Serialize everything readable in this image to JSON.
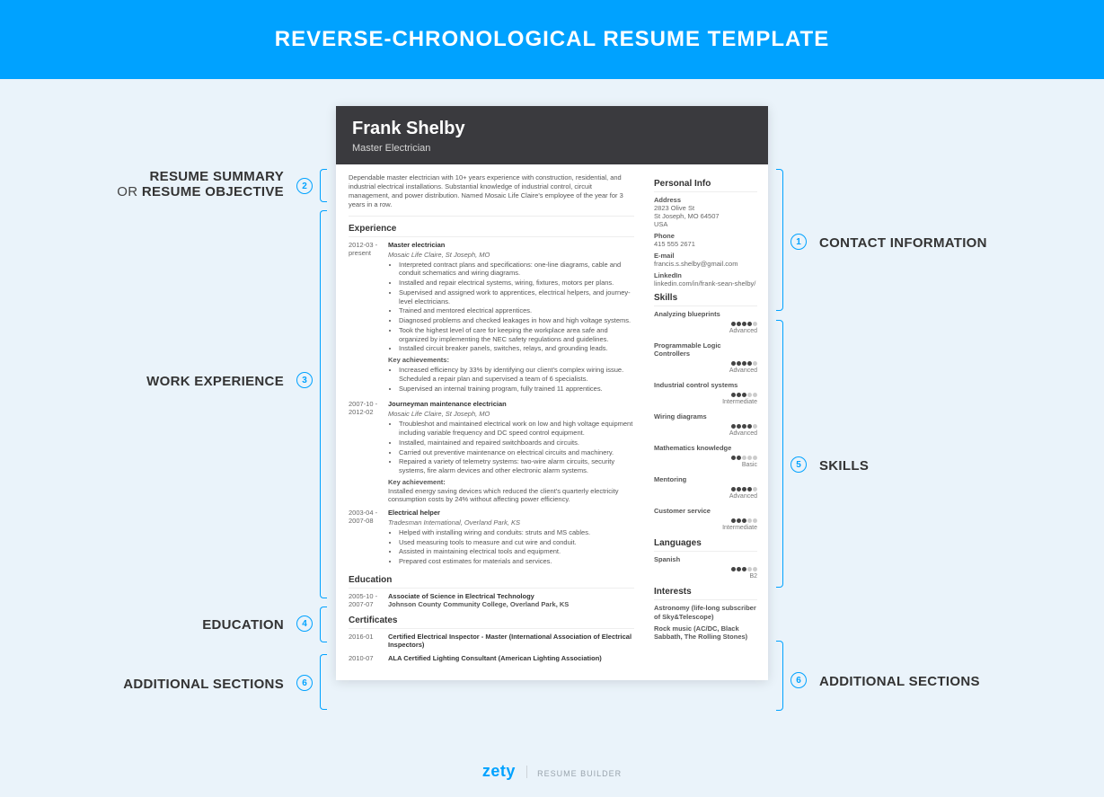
{
  "banner": {
    "title": "REVERSE-CHRONOLOGICAL RESUME TEMPLATE"
  },
  "labels": {
    "summary_l1": "RESUME SUMMARY",
    "summary_l2_pre": "OR ",
    "summary_l2": "RESUME OBJECTIVE",
    "experience": "WORK EXPERIENCE",
    "education": "EDUCATION",
    "additional": "ADDITIONAL SECTIONS",
    "contact": "CONTACT INFORMATION",
    "skills": "SKILLS",
    "additional_r": "ADDITIONAL SECTIONS"
  },
  "badges": {
    "n1": "1",
    "n2": "2",
    "n3": "3",
    "n4": "4",
    "n5": "5",
    "n6": "6",
    "n6b": "6"
  },
  "resume": {
    "name": "Frank Shelby",
    "role": "Master Electrician",
    "summary": "Dependable master electrician with 10+ years experience with construction, residential, and industrial electrical installations. Substantial knowledge of industrial control, circuit management, and power distribution. Named Mosaic Life Claire's employee of the year for 3 years in a row.",
    "sections": {
      "experience": "Experience",
      "education": "Education",
      "certificates": "Certificates",
      "personal": "Personal Info",
      "skills": "Skills",
      "languages": "Languages",
      "interests": "Interests"
    },
    "jobs": [
      {
        "dates": "2012-03 - present",
        "title": "Master electrician",
        "loc": "Mosaic Life Claire, St Joseph, MO",
        "bullets": [
          "Interpreted contract plans and specifications: one-line diagrams, cable and conduit schematics and wiring diagrams.",
          "Installed and repair electrical systems, wiring, fixtures, motors per plans.",
          "Supervised and assigned work to apprentices, electrical helpers, and journey-level electricians.",
          "Trained and mentored electrical apprentices.",
          "Diagnosed problems and checked leakages in how and high voltage systems.",
          "Took the highest level of care for keeping the workplace area safe and organized by implementing the NEC safety regulations and guidelines.",
          "Installed circuit breaker panels, switches, relays, and grounding leads."
        ],
        "key_label": "Key achievements:",
        "key_bullets": [
          "Increased efficiency by 33% by identifying our client's complex wiring issue. Scheduled a repair plan and supervised a team of 6 specialists.",
          "Supervised an internal training program, fully trained 11 apprentices."
        ]
      },
      {
        "dates": "2007-10 - 2012-02",
        "title": "Journeyman maintenance electrician",
        "loc": "Mosaic Life Claire, St Joseph, MO",
        "bullets": [
          "Troubleshot and maintained electrical work on low and high voltage equipment including variable frequency and DC speed control equipment.",
          "Installed, maintained and repaired switchboards and circuits.",
          "Carried out preventive maintenance on electrical circuits and machinery.",
          "Repaired a variety of telemetry systems: two-wire alarm circuits, security systems, fire alarm devices and other electronic alarm systems."
        ],
        "key_label": "Key achievement:",
        "key_text": "Installed energy saving devices which reduced the client's quarterly electricity consumption costs by 24% without affecting power efficiency."
      },
      {
        "dates": "2003-04 - 2007-08",
        "title": "Electrical helper",
        "loc": "Tradesman International, Overland Park, KS",
        "bullets": [
          "Helped with installing wiring and conduits: struts and MS cables.",
          "Used measuring tools to measure and cut wire and conduit.",
          "Assisted in maintaining electrical tools and equipment.",
          "Prepared cost estimates for materials and services."
        ]
      }
    ],
    "education": {
      "dates": "2005-10 - 2007-07",
      "degree": "Associate of Science in Electrical Technology",
      "school": "Johnson County Community College, Overland Park, KS"
    },
    "certs": [
      {
        "date": "2016-01",
        "text": "Certified Electrical Inspector - Master (International Association of Electrical Inspectors)"
      },
      {
        "date": "2010-07",
        "text": "ALA Certified Lighting Consultant (American Lighting Association)"
      }
    ],
    "personal": {
      "address_label": "Address",
      "address_l1": "2823 Olive St",
      "address_l2": "St Joseph, MO 64507",
      "address_l3": "USA",
      "phone_label": "Phone",
      "phone": "415 555 2671",
      "email_label": "E-mail",
      "email": "francis.s.shelby@gmail.com",
      "linkedin_label": "LinkedIn",
      "linkedin": "linkedin.com/in/frank-sean-shelby/"
    },
    "skills": [
      {
        "name": "Analyzing blueprints",
        "level": "Advanced",
        "dots": 4
      },
      {
        "name": "Programmable Logic Controllers",
        "level": "Advanced",
        "dots": 4
      },
      {
        "name": "Industrial control systems",
        "level": "Intermediate",
        "dots": 3
      },
      {
        "name": "Wiring diagrams",
        "level": "Advanced",
        "dots": 4
      },
      {
        "name": "Mathematics knowledge",
        "level": "Basic",
        "dots": 2
      },
      {
        "name": "Mentoring",
        "level": "Advanced",
        "dots": 4
      },
      {
        "name": "Customer service",
        "level": "Intermediate",
        "dots": 3
      }
    ],
    "languages": [
      {
        "name": "Spanish",
        "score": "B2",
        "dots": 3
      }
    ],
    "interests": [
      "Astronomy (life-long subscriber of Sky&Telescope)",
      "Rock music (AC/DC, Black Sabbath, The Rolling Stones)"
    ]
  },
  "footer": {
    "brand": "zety",
    "sub": "RESUME BUILDER"
  }
}
